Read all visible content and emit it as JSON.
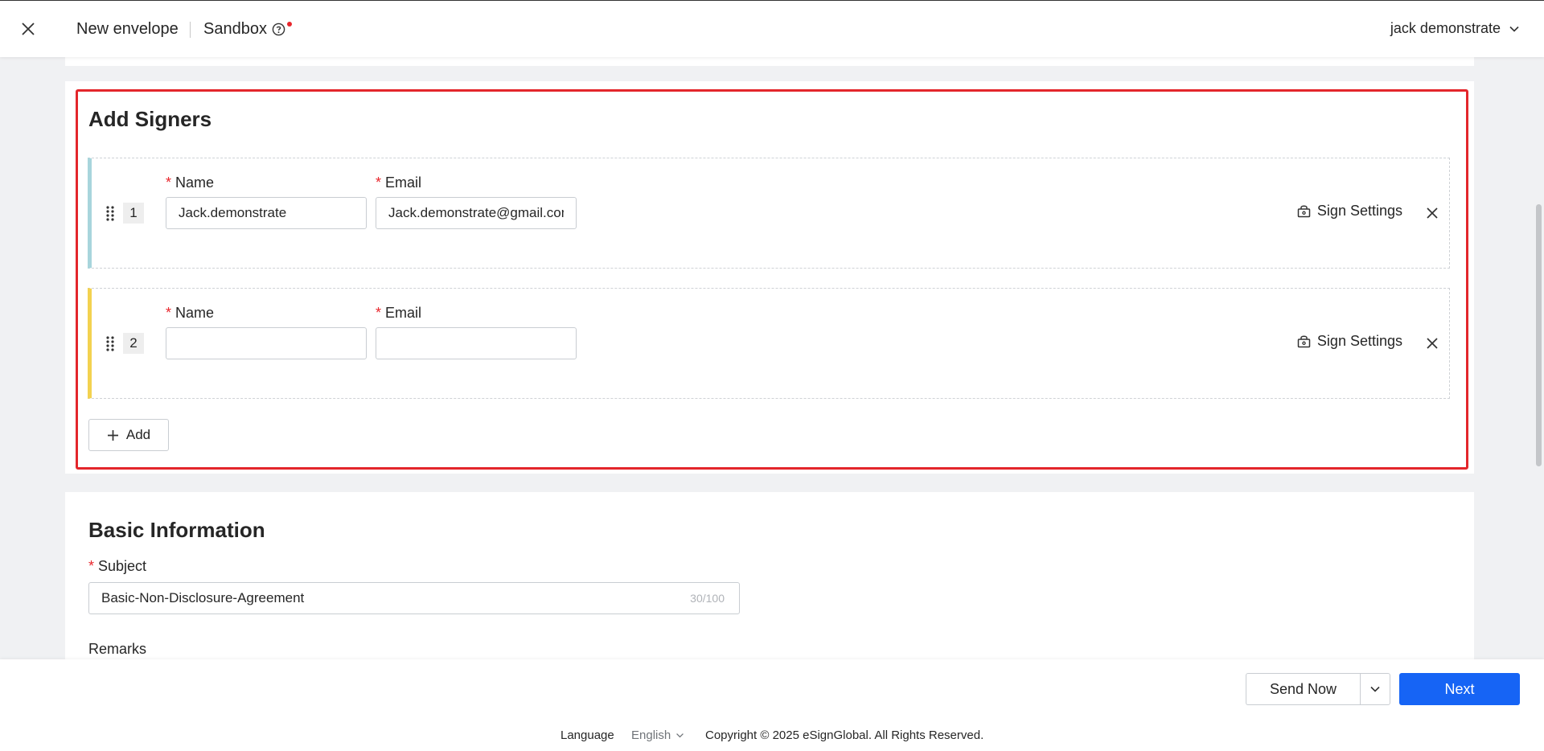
{
  "header": {
    "title": "New envelope",
    "env": "Sandbox",
    "user": "jack demonstrate"
  },
  "signers": {
    "title": "Add Signers",
    "name_label": "Name",
    "email_label": "Email",
    "settings_label": "Sign Settings",
    "add_label": "Add",
    "rows": [
      {
        "order": "1",
        "name": "Jack.demonstrate",
        "email": "Jack.demonstrate@gmail.com"
      },
      {
        "order": "2",
        "name": "",
        "email": ""
      }
    ]
  },
  "basic": {
    "title": "Basic Information",
    "subject_label": "Subject",
    "subject_value": "Basic-Non-Disclosure-Agreement",
    "subject_counter": "30/100",
    "remarks_label": "Remarks"
  },
  "actions": {
    "send_now": "Send Now",
    "next": "Next"
  },
  "footer": {
    "language_label": "Language",
    "language_value": "English",
    "copyright": "Copyright © 2025 eSignGlobal. All Rights Reserved."
  },
  "colors": {
    "accent": "#1664f5",
    "highlight": "#e3262b",
    "signer1_bar": "#a8d5dc",
    "signer2_bar": "#f3d250"
  }
}
